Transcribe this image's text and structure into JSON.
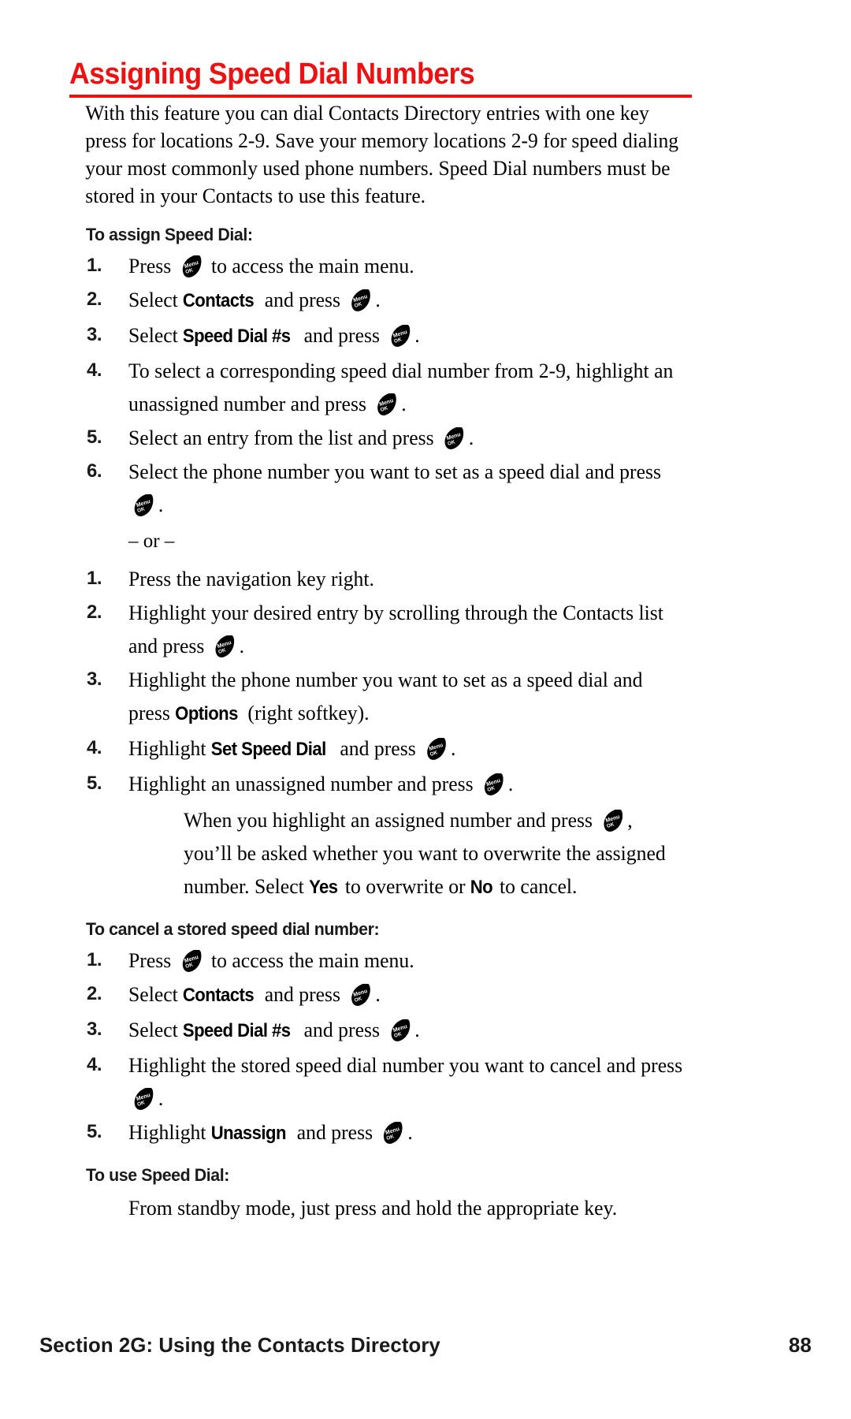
{
  "page": {
    "title": "Assigning Speed Dial Numbers",
    "accent_color": "#ee1111",
    "intro": "With this feature you can dial Contacts Directory entries with one key press for locations 2-9. Save your memory locations 2-9 for speed dialing your most commonly used phone numbers. Speed Dial numbers must be stored in your Contacts to use this feature."
  },
  "section_assign": {
    "heading": "To assign Speed Dial:",
    "steps": [
      {
        "num": "1.",
        "pre": "Press ",
        "icon": "menu-ok-key-icon",
        "post": " to access the main menu."
      },
      {
        "num": "2.",
        "pre": "Select ",
        "bold": "Contacts",
        "mid": " and press ",
        "icon": "menu-ok-key-icon",
        "post": "."
      },
      {
        "num": "3.",
        "pre": "Select ",
        "bold": "Speed Dial #s",
        "mid": " and press ",
        "icon": "menu-ok-key-icon",
        "post": "."
      },
      {
        "num": "4.",
        "pre": "To select a corresponding speed dial number from 2-9, highlight an unassigned number and press ",
        "icon": "menu-ok-key-icon",
        "post": "."
      },
      {
        "num": "5.",
        "pre": "Select an entry from the list and press ",
        "icon": "menu-ok-key-icon",
        "post": "."
      },
      {
        "num": "6.",
        "pre": "Select the phone number you want to set as a speed dial and press ",
        "icon": "menu-ok-key-icon",
        "post": "."
      }
    ],
    "or_label": "– or –",
    "alt_steps": [
      {
        "num": "1.",
        "pre": "Press the navigation key right.",
        "icon": "",
        "post": ""
      },
      {
        "num": "2.",
        "pre": "Highlight your desired entry by scrolling through the Contacts list and press ",
        "icon": "menu-ok-key-icon",
        "post": "."
      },
      {
        "num": "3.",
        "pre": "Highlight the phone number you want to set as a speed dial and press ",
        "bold": "Options",
        "mid": " (right softkey).",
        "icon": "",
        "post": ""
      },
      {
        "num": "4.",
        "pre": "Highlight ",
        "bold": "Set Speed Dial",
        "mid": " and press ",
        "icon": "menu-ok-key-icon",
        "post": "."
      },
      {
        "num": "5.",
        "pre": "Highlight an unassigned number and press ",
        "icon": "menu-ok-key-icon",
        "post": "."
      }
    ],
    "note": {
      "pre": "When you highlight an assigned number and press ",
      "icon": "menu-ok-key-icon",
      "mid": ", you’ll be asked whether you want to overwrite the assigned number. Select ",
      "bold1": "Yes",
      "mid2": " to overwrite or ",
      "bold2": "No",
      "post": " to cancel."
    }
  },
  "section_cancel": {
    "heading": "To cancel a stored speed dial number:",
    "steps": [
      {
        "num": "1.",
        "pre": "Press ",
        "icon": "menu-ok-key-icon",
        "post": " to access the main menu."
      },
      {
        "num": "2.",
        "pre": "Select ",
        "bold": "Contacts",
        "mid": " and press ",
        "icon": "menu-ok-key-icon",
        "post": "."
      },
      {
        "num": "3.",
        "pre": "Select ",
        "bold": "Speed Dial #s",
        "mid": " and press ",
        "icon": "menu-ok-key-icon",
        "post": "."
      },
      {
        "num": "4.",
        "pre": "Highlight the stored speed dial number you want to cancel and press ",
        "icon": "menu-ok-key-icon",
        "post": "."
      },
      {
        "num": "5.",
        "pre": "Highlight ",
        "bold": "Unassign",
        "mid": " and press ",
        "icon": "menu-ok-key-icon",
        "post": "."
      }
    ]
  },
  "section_use": {
    "heading": "To use Speed Dial:",
    "body": "From standby mode, just press and hold the appropriate key."
  },
  "icon_labels": {
    "menu": "Menu",
    "ok": "OK"
  },
  "footer": {
    "section_label": "Section 2G: Using the Contacts Directory",
    "page_number": "88"
  }
}
